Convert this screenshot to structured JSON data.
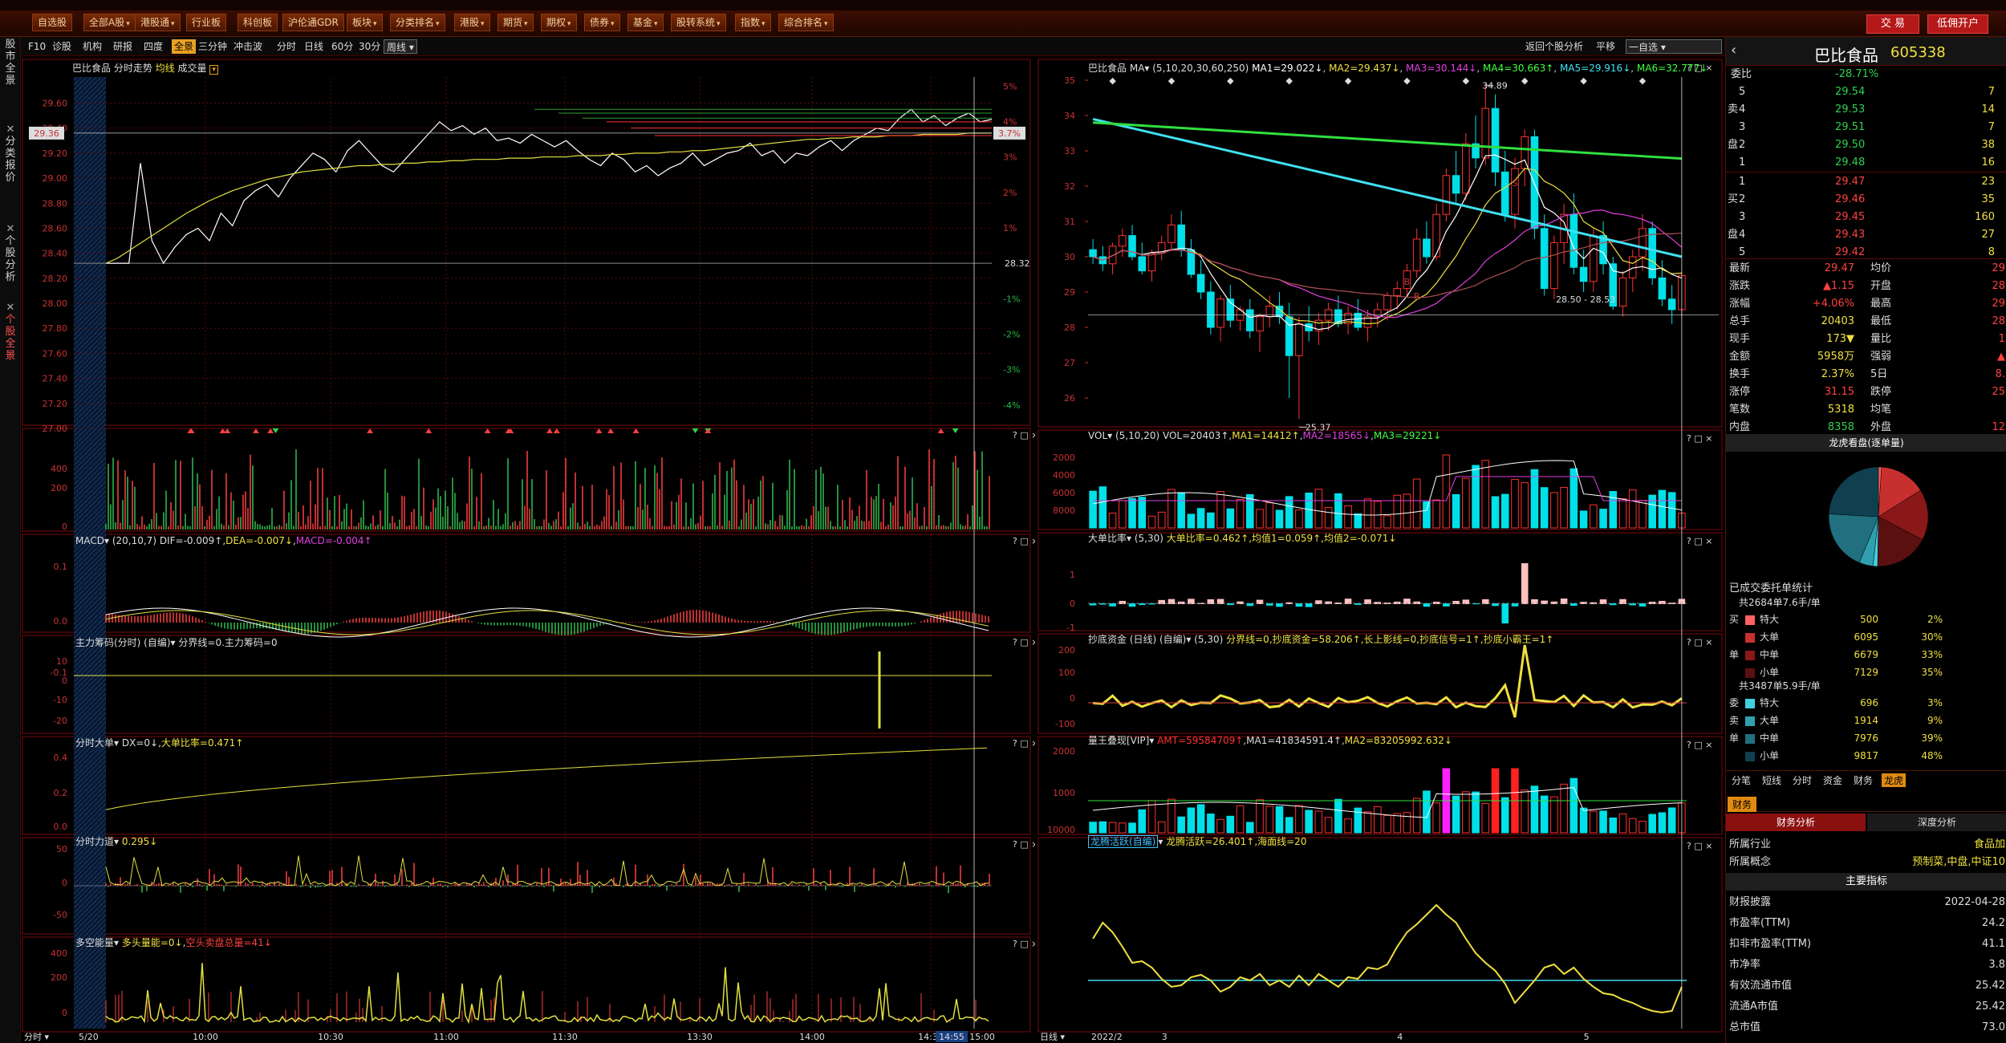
{
  "window_title": "巴比食品 - 个股全景",
  "menu": [
    {
      "label": "自选股",
      "dd": false
    },
    {
      "label": "全部A股",
      "dd": true
    },
    {
      "label": "港股通",
      "dd": true
    },
    {
      "label": "行业板",
      "dd": false
    },
    {
      "label": "科创板",
      "dd": false
    },
    {
      "label": "沪伦通GDR",
      "dd": false
    },
    {
      "label": "板块",
      "dd": true
    },
    {
      "label": "分类排名",
      "dd": true
    },
    {
      "label": "港股",
      "dd": true
    },
    {
      "label": "期货",
      "dd": true
    },
    {
      "label": "期权",
      "dd": true
    },
    {
      "label": "债券",
      "dd": true
    },
    {
      "label": "基金",
      "dd": true
    },
    {
      "label": "股转系统",
      "dd": true
    },
    {
      "label": "指数",
      "dd": true
    },
    {
      "label": "综合排名",
      "dd": true
    }
  ],
  "trade_button": "交 易",
  "open_account_button": "低佣开户",
  "sidebar_tabs": [
    "股市全景",
    "分类报价",
    "个股分析",
    "个股全景"
  ],
  "toolbar": {
    "left": [
      "F10",
      "诊股",
      "机构",
      "研报",
      "四度",
      "全景",
      "三分钟",
      "冲击波"
    ],
    "periods": [
      "分时",
      "日线",
      "60分",
      "30分",
      "周线"
    ],
    "right": [
      "返回个股分析",
      "平移",
      "一自选"
    ]
  },
  "intraday": {
    "title": "巴比食品  分时走势",
    "avg_label": "均线",
    "vol_label": "成交量",
    "price_ticks": [
      "29.60",
      "29.40",
      "29.20",
      "29.00",
      "28.80",
      "28.60",
      "28.40",
      "28.20",
      "28.00",
      "27.80",
      "27.60",
      "27.40",
      "27.20",
      "27.00"
    ],
    "pct_ticks": [
      "5%",
      "4%",
      "3%",
      "2%",
      "1%",
      "",
      "-1%",
      "-2%",
      "-3%",
      "-4%"
    ],
    "last_price_tag": "29.36",
    "last_pct_tag": "3.7%",
    "prev_close_tag": "28.32",
    "vol_ticks": [
      "400",
      "200",
      "0"
    ],
    "time_ticks": [
      "5/20",
      "10:00",
      "10:30",
      "11:00",
      "11:30",
      "13:30",
      "14:00",
      "14:30",
      "14:55",
      "15:00"
    ],
    "time_mode": "分时"
  },
  "macd": {
    "title": "MACD",
    "params": "(20,10,7)",
    "dif": "DIF=-0.009↑",
    "dea": "DEA=-0.007↓",
    "macd": "MACD=-0.004↑",
    "ticks": [
      "0.1",
      "0.0",
      "-0.1"
    ]
  },
  "zhuli": {
    "title": "主力筹码(分时)  (自编)",
    "text": "分界线=0.主力筹码=0",
    "ticks": [
      "10",
      "0",
      "-10",
      "-20"
    ]
  },
  "fsdadan": {
    "title": "分时大单",
    "dx": "DX=0↓",
    "ratio": "大单比率=0.471↑",
    "ticks": [
      "0.4",
      "0.2",
      "0.0"
    ]
  },
  "fsld": {
    "title": "分时力道",
    "val": "0.295↓",
    "ticks": [
      "50",
      "0",
      "-50"
    ]
  },
  "dkn": {
    "title": "多空能量",
    "a": "多头量能=0↓",
    "b": "空头卖盘总量=41↓",
    "ticks": [
      "400",
      "200",
      "0"
    ]
  },
  "kline": {
    "title": "巴比食品",
    "ma_params": "(5,10,20,30,60,250)",
    "ma": [
      "MA1=29.022↓",
      "MA2=29.437↓",
      "MA3=30.144↓",
      "MA4=30.663↑",
      "MA5=29.916↓",
      "MA6=32.777↓"
    ],
    "ma_colors": [
      "#ffffff",
      "#f0e040",
      "#e040e0",
      "#40ff40",
      "#40e0f0",
      "#40ff40"
    ],
    "ticks": [
      "35",
      "34",
      "33",
      "32",
      "31",
      "30",
      "29",
      "28",
      "27",
      "26"
    ],
    "high_label": "34.89",
    "low_label": "25.37",
    "range_label": "28.50 - 28.53",
    "dates": [
      "2022/2",
      "3",
      "4",
      "5"
    ],
    "time_mode": "日线",
    "b_marks": [
      "B",
      "B"
    ],
    "s_mark": "S"
  },
  "vol_panel": {
    "title": "VOL",
    "params": "(5,10,20)",
    "vals": [
      "VOL=20403↑",
      "MA1=14412↑",
      "MA2=18565↓",
      "MA3=29221↓"
    ],
    "ticks": [
      "8000",
      "6000",
      "4000",
      "2000"
    ]
  },
  "dadan_panel": {
    "title": "大单比率",
    "params": "(5,30)",
    "text": "大单比率=0.462↑,均值1=0.059↑,均值2=-0.071↓",
    "ticks": [
      "1",
      "0",
      "-1"
    ]
  },
  "chaodi_panel": {
    "title": "抄底资金 (日线) (自编)",
    "params": "(5,30)",
    "text": "分界线=0,抄底资金=58.206↑,长上影线=0,抄底信号=1↑,抄底小霸王=1↑",
    "ticks": [
      "200",
      "100",
      "0",
      "-100"
    ]
  },
  "lwjb_panel": {
    "title": "量王叠现[VIP]",
    "amt": "AMT=59584709↑",
    "ma1": "MA1=41834591.4↑",
    "ma2": "MA2=83205992.632↓",
    "ticks": [
      "2000",
      "1000",
      "10000"
    ]
  },
  "lthy_panel": {
    "title": "龙腾活跃(自编)",
    "text": "龙腾活跃=26.401↑,海面线=20"
  },
  "quote": {
    "name": "巴比食品",
    "code": "605338",
    "weibi": "委比",
    "weibi_val": "-28.71%",
    "weicha_val": "-",
    "sell": [
      [
        "5",
        "29.54",
        "7"
      ],
      [
        "4",
        "29.53",
        "14"
      ],
      [
        "3",
        "29.51",
        "7"
      ],
      [
        "2",
        "29.50",
        "38"
      ],
      [
        "1",
        "29.48",
        "16"
      ]
    ],
    "buy": [
      [
        "1",
        "29.47",
        "23"
      ],
      [
        "2",
        "29.46",
        "35"
      ],
      [
        "3",
        "29.45",
        "160"
      ],
      [
        "4",
        "29.43",
        "27"
      ],
      [
        "5",
        "29.42",
        "8"
      ]
    ],
    "stats": [
      [
        "最新",
        "29.47",
        "均价",
        "29"
      ],
      [
        "涨跌",
        "▲1.15",
        "开盘",
        "28"
      ],
      [
        "涨幅",
        "+4.06%",
        "最高",
        "29"
      ],
      [
        "总手",
        "20403",
        "最低",
        "28"
      ],
      [
        "现手",
        "173▼",
        "量比",
        "1"
      ],
      [
        "金额",
        "5958万",
        "强弱",
        "▲"
      ],
      [
        "换手",
        "2.37%",
        "5日",
        "8."
      ],
      [
        "涨停",
        "31.15",
        "跌停",
        "25"
      ],
      [
        "笔数",
        "5318",
        "均笔",
        ""
      ],
      [
        "内盘",
        "8358",
        "外盘",
        "12"
      ]
    ],
    "lhkp": "龙虎看盘(逐单量)",
    "wt_title": "已成交委托单统计",
    "buy_total": "共2684单7.6手/单",
    "buy_rows": [
      [
        "特大",
        "500",
        "2%"
      ],
      [
        "大单",
        "6095",
        "30%"
      ],
      [
        "中单",
        "6679",
        "33%"
      ],
      [
        "小单",
        "7129",
        "35%"
      ]
    ],
    "sell_total": "共3487单5.9手/单",
    "sell_rows": [
      [
        "特大",
        "696",
        "3%"
      ],
      [
        "大单",
        "1914",
        "9%"
      ],
      [
        "中单",
        "7976",
        "39%"
      ],
      [
        "小单",
        "9817",
        "48%"
      ]
    ],
    "tabs": [
      "分笔",
      "短线",
      "分时",
      "资金",
      "财务",
      "龙虎"
    ],
    "cw_tab": "财务",
    "subtabs": [
      "财务分析",
      "深度分析"
    ],
    "fin": [
      [
        "所属行业",
        "食品加"
      ],
      [
        "所属概念",
        "预制菜,中盘,中证10"
      ]
    ],
    "fin_title": "主要指标",
    "fin2": [
      [
        "财报披露",
        "2022-04-28"
      ],
      [
        "市盈率(TTM)",
        "24.2"
      ],
      [
        "扣非市盈率(TTM)",
        "41.1"
      ],
      [
        "市净率",
        "3.8"
      ],
      [
        "有效流通市值",
        "25.42"
      ],
      [
        "流通A市值",
        "25.42"
      ],
      [
        "总市值",
        "73.0"
      ]
    ]
  },
  "chart_data": [
    {
      "type": "line",
      "name": "intraday",
      "x_start": "09:30",
      "x_end": "15:00",
      "ylim": [
        27.0,
        29.68
      ],
      "prev_close": 28.32,
      "series": [
        {
          "name": "价格",
          "values": [
            28.32,
            28.32,
            28.32,
            29.12,
            28.5,
            28.32,
            28.45,
            28.55,
            28.6,
            28.5,
            28.72,
            28.62,
            28.82,
            28.9,
            28.95,
            28.85,
            29.0,
            29.1,
            29.2,
            29.15,
            29.05,
            29.22,
            29.3,
            29.2,
            29.1,
            29.05,
            29.15,
            29.25,
            29.35,
            29.45,
            29.38,
            29.42,
            29.35,
            29.4,
            29.3,
            29.32,
            29.28,
            29.35,
            29.3,
            29.25,
            29.3,
            29.22,
            29.15,
            29.1,
            29.2,
            29.15,
            29.05,
            29.1,
            29.02,
            29.08,
            29.12,
            29.2,
            29.1,
            29.15,
            29.2,
            29.22,
            29.28,
            29.18,
            29.22,
            29.12,
            29.2,
            29.18,
            29.25,
            29.3,
            29.22,
            29.3,
            29.35,
            29.4,
            29.38,
            29.48,
            29.55,
            29.45,
            29.5,
            29.42,
            29.48,
            29.52,
            29.45,
            29.47
          ]
        },
        {
          "name": "均价",
          "values": [
            28.32,
            28.36,
            28.42,
            28.48,
            28.54,
            28.6,
            28.66,
            28.72,
            28.77,
            28.82,
            28.86,
            28.9,
            28.93,
            28.96,
            28.99,
            29.01,
            29.03,
            29.05,
            29.06,
            29.07,
            29.08,
            29.09,
            29.1,
            29.1,
            29.11,
            29.11,
            29.12,
            29.12,
            29.13,
            29.13,
            29.14,
            29.14,
            29.15,
            29.15,
            29.15,
            29.16,
            29.16,
            29.16,
            29.17,
            29.17,
            29.17,
            29.18,
            29.18,
            29.18,
            29.19,
            29.19,
            29.2,
            29.2,
            29.2,
            29.21,
            29.21,
            29.22,
            29.22,
            29.23,
            29.24,
            29.25,
            29.26,
            29.27,
            29.28,
            29.29,
            29.3,
            29.31,
            29.31,
            29.32,
            29.32,
            29.33,
            29.33,
            29.33,
            29.34,
            29.34,
            29.34,
            29.35,
            29.35,
            29.35,
            29.35,
            29.36,
            29.36,
            29.36
          ]
        }
      ]
    },
    {
      "type": "candlestick",
      "name": "daily",
      "ylim": [
        25,
        35
      ],
      "candles": [
        [
          30.2,
          30.5,
          29.8,
          30.0
        ],
        [
          30.0,
          30.3,
          29.6,
          29.8
        ],
        [
          29.8,
          30.4,
          29.5,
          30.3
        ],
        [
          30.3,
          30.8,
          30.0,
          30.6
        ],
        [
          30.6,
          30.9,
          29.9,
          30.0
        ],
        [
          30.0,
          30.4,
          29.5,
          29.6
        ],
        [
          29.6,
          30.2,
          29.3,
          30.1
        ],
        [
          30.1,
          30.6,
          29.9,
          30.4
        ],
        [
          30.4,
          31.2,
          30.2,
          30.9
        ],
        [
          30.9,
          31.3,
          30.0,
          30.2
        ],
        [
          30.2,
          30.5,
          29.4,
          29.5
        ],
        [
          29.5,
          29.9,
          28.8,
          29.0
        ],
        [
          29.0,
          29.3,
          27.8,
          28.0
        ],
        [
          28.0,
          28.9,
          27.6,
          28.8
        ],
        [
          28.8,
          29.2,
          28.0,
          28.2
        ],
        [
          28.2,
          28.6,
          27.9,
          28.5
        ],
        [
          28.5,
          28.8,
          27.7,
          27.9
        ],
        [
          27.9,
          28.4,
          27.3,
          28.3
        ],
        [
          28.3,
          28.9,
          28.0,
          28.6
        ],
        [
          28.6,
          29.0,
          28.1,
          28.3
        ],
        [
          28.3,
          28.7,
          26.0,
          27.2
        ],
        [
          27.2,
          28.3,
          25.4,
          28.1
        ],
        [
          28.1,
          28.6,
          27.6,
          27.9
        ],
        [
          27.9,
          28.4,
          27.5,
          28.2
        ],
        [
          28.2,
          28.7,
          27.9,
          28.5
        ],
        [
          28.5,
          28.9,
          28.0,
          28.1
        ],
        [
          28.1,
          28.6,
          27.8,
          28.4
        ],
        [
          28.4,
          28.8,
          27.9,
          28.0
        ],
        [
          28.0,
          28.5,
          27.6,
          28.3
        ],
        [
          28.3,
          28.7,
          28.0,
          28.5
        ],
        [
          28.5,
          29.0,
          28.2,
          28.9
        ],
        [
          28.9,
          29.3,
          28.5,
          29.1
        ],
        [
          29.1,
          29.8,
          28.9,
          29.6
        ],
        [
          29.6,
          30.8,
          29.4,
          30.5
        ],
        [
          30.5,
          31.0,
          29.8,
          30.0
        ],
        [
          30.0,
          31.5,
          29.9,
          31.2
        ],
        [
          31.2,
          32.5,
          31.0,
          32.3
        ],
        [
          32.3,
          33.0,
          31.5,
          31.8
        ],
        [
          31.8,
          33.5,
          31.6,
          33.2
        ],
        [
          33.2,
          34.0,
          32.5,
          32.8
        ],
        [
          32.8,
          34.9,
          32.6,
          34.2
        ],
        [
          34.2,
          34.6,
          32.0,
          32.4
        ],
        [
          32.4,
          33.0,
          31.0,
          31.2
        ],
        [
          31.2,
          32.8,
          30.8,
          32.5
        ],
        [
          32.5,
          33.6,
          32.0,
          33.4
        ],
        [
          33.4,
          33.6,
          30.5,
          30.8
        ],
        [
          30.8,
          31.2,
          28.9,
          29.1
        ],
        [
          29.1,
          30.6,
          28.8,
          30.4
        ],
        [
          30.4,
          31.5,
          29.8,
          31.2
        ],
        [
          31.2,
          31.8,
          29.5,
          29.7
        ],
        [
          29.7,
          30.2,
          29.0,
          29.3
        ],
        [
          29.3,
          30.8,
          29.0,
          30.6
        ],
        [
          30.6,
          31.0,
          29.5,
          29.8
        ],
        [
          29.8,
          30.0,
          28.5,
          28.6
        ],
        [
          28.6,
          29.6,
          28.3,
          29.4
        ],
        [
          29.4,
          30.2,
          29.0,
          30.0
        ],
        [
          30.0,
          31.2,
          29.6,
          30.8
        ],
        [
          30.8,
          31.0,
          29.2,
          29.4
        ],
        [
          29.4,
          29.9,
          28.6,
          28.8
        ],
        [
          28.8,
          29.2,
          28.1,
          28.5
        ],
        [
          28.5,
          29.6,
          28.3,
          29.47
        ]
      ]
    }
  ]
}
